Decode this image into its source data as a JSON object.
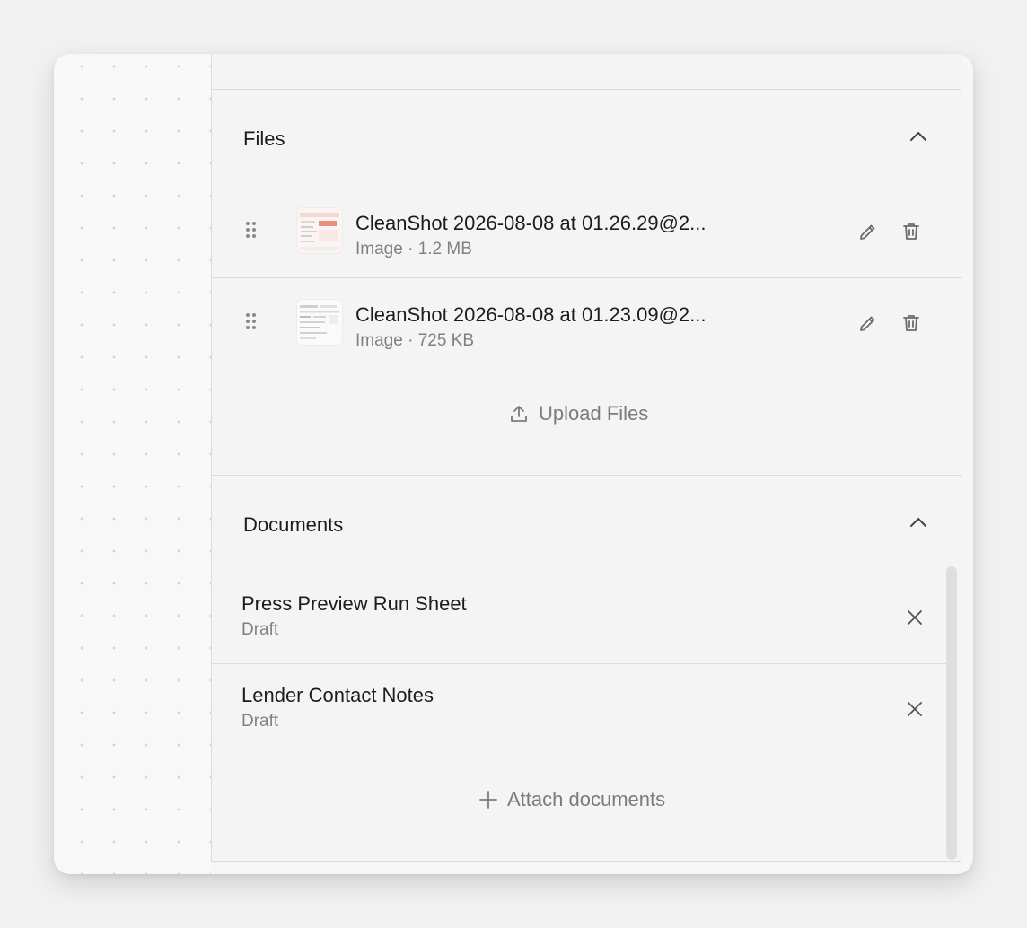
{
  "files": {
    "title": "Files",
    "collapse_icon": "chevron-up-icon",
    "items": [
      {
        "name": "CleanShot 2026-08-08 at 01.26.29@2...",
        "meta": "Image · 1.2 MB"
      },
      {
        "name": "CleanShot 2026-08-08 at 01.23.09@2...",
        "meta": "Image · 725 KB"
      }
    ],
    "upload_label": "Upload Files",
    "upload_icon": "upload-icon"
  },
  "documents": {
    "title": "Documents",
    "collapse_icon": "chevron-up-icon",
    "items": [
      {
        "title": "Press Preview Run Sheet",
        "status": "Draft"
      },
      {
        "title": "Lender Contact Notes",
        "status": "Draft"
      }
    ],
    "attach_label": "Attach documents",
    "attach_icon": "plus-icon"
  },
  "colors": {
    "text_primary": "#1c1c1c",
    "text_secondary": "#808080",
    "icon": "#6b6b6b",
    "divider": "#dcdcdc",
    "panel_bg": "#f4f4f4"
  }
}
